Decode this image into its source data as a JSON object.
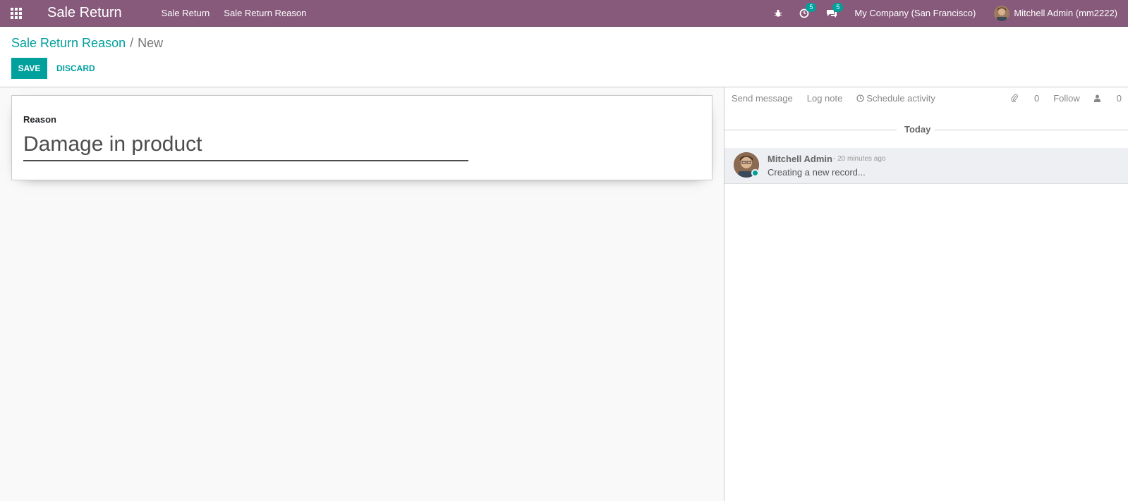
{
  "navbar": {
    "app_title": "Sale Return",
    "menu": [
      {
        "label": "Sale Return"
      },
      {
        "label": "Sale Return Reason"
      }
    ],
    "activity_count": "5",
    "messages_count": "5",
    "company": "My Company (San Francisco)",
    "user": "Mitchell Admin (mm2222)",
    "brand_color": "#875a7b"
  },
  "breadcrumb": {
    "parent": "Sale Return Reason",
    "separator": "/",
    "current": "New"
  },
  "buttons": {
    "save": "SAVE",
    "discard": "DISCARD",
    "accent_color": "#00a09d"
  },
  "form": {
    "reason_label": "Reason",
    "reason_value": "Damage in product"
  },
  "chatter": {
    "send_message": "Send message",
    "log_note": "Log note",
    "schedule_activity": "Schedule activity",
    "attachments_count": "0",
    "follow": "Follow",
    "followers_count": "0",
    "date_separator": "Today",
    "messages": [
      {
        "author": "Mitchell Admin",
        "date": "- 20 minutes ago",
        "body": "Creating a new record..."
      }
    ]
  }
}
